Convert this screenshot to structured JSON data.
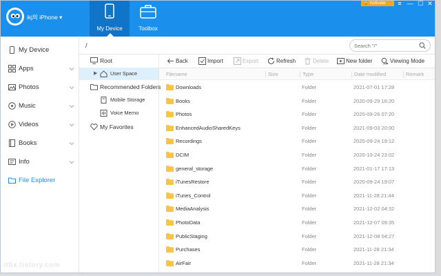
{
  "header": {
    "device_name": "ikj의 iPhone ▾",
    "tabs": [
      {
        "label": "My Device",
        "icon": "phone-icon"
      },
      {
        "label": "Toolbox",
        "icon": "toolbox-icon"
      }
    ],
    "activate_label": "Activate",
    "window_controls": {
      "menu": "≡",
      "minimize": "—",
      "maximize": "☐",
      "close": "✕"
    }
  },
  "sidebar": {
    "items": [
      {
        "label": "My Device",
        "icon": "device-icon",
        "has_chevron": false
      },
      {
        "label": "Apps",
        "icon": "apps-icon",
        "has_chevron": true
      },
      {
        "label": "Photos",
        "icon": "photos-icon",
        "has_chevron": true
      },
      {
        "label": "Music",
        "icon": "music-icon",
        "has_chevron": true
      },
      {
        "label": "Videos",
        "icon": "videos-icon",
        "has_chevron": true
      },
      {
        "label": "Books",
        "icon": "books-icon",
        "has_chevron": true
      },
      {
        "label": "Info",
        "icon": "info-icon",
        "has_chevron": true
      },
      {
        "label": "File Explorer",
        "icon": "folder-icon",
        "has_chevron": false,
        "active": true
      }
    ]
  },
  "path": {
    "current": "/"
  },
  "search": {
    "placeholder": "Search \"/\""
  },
  "tree": {
    "root": "Root",
    "user_space": "User Space",
    "recommended": "Recommended Folders",
    "mobile_storage": "Mobile Storage",
    "voice_memo": "Voice Memo",
    "favorites": "My Favorites"
  },
  "toolbar": {
    "back": "Back",
    "import": "Import",
    "export": "Export",
    "refresh": "Refresh",
    "delete": "Delete",
    "new_folder": "New folder",
    "viewing_mode": "Viewing Mode"
  },
  "table": {
    "columns": [
      "Filename",
      "Size",
      "Type",
      "Date modified",
      "Remark"
    ],
    "rows": [
      {
        "name": "Downloads",
        "type": "Folder",
        "date": "2021-07-01 17:28"
      },
      {
        "name": "Books",
        "type": "Folder",
        "date": "2020-09-29 16:20"
      },
      {
        "name": "Photos",
        "type": "Folder",
        "date": "2020-09-26 07:20"
      },
      {
        "name": "EnhancedAudioSharedKeys",
        "type": "Folder",
        "date": "2021-09-03 20:00"
      },
      {
        "name": "Recordings",
        "type": "Folder",
        "date": "2020-09-24 19:12"
      },
      {
        "name": "DCIM",
        "type": "Folder",
        "date": "2020-10-24 23:02"
      },
      {
        "name": "general_storage",
        "type": "Folder",
        "date": "2021-01-17 17:13"
      },
      {
        "name": "iTunesRestore",
        "type": "Folder",
        "date": "2020-09-24 19:07"
      },
      {
        "name": "iTunes_Control",
        "type": "Folder",
        "date": "2021-11-28 21:44"
      },
      {
        "name": "MediaAnalysis",
        "type": "Folder",
        "date": "2021-12-02 04:32"
      },
      {
        "name": "PhotoData",
        "type": "Folder",
        "date": "2021-12-07 09:35"
      },
      {
        "name": "PublicStaging",
        "type": "Folder",
        "date": "2021-12-08 04:27"
      },
      {
        "name": "Purchases",
        "type": "Folder",
        "date": "2021-11-28 21:34"
      },
      {
        "name": "AirFair",
        "type": "Folder",
        "date": "2021-11-28 21:34"
      }
    ]
  },
  "watermark": "itfix.tistory.com",
  "colors": {
    "accent": "#1b8fec",
    "accent_dark": "#1074c9",
    "folder": "#f9c440",
    "activate": "#f5a623",
    "selected": "#dff0fd"
  }
}
